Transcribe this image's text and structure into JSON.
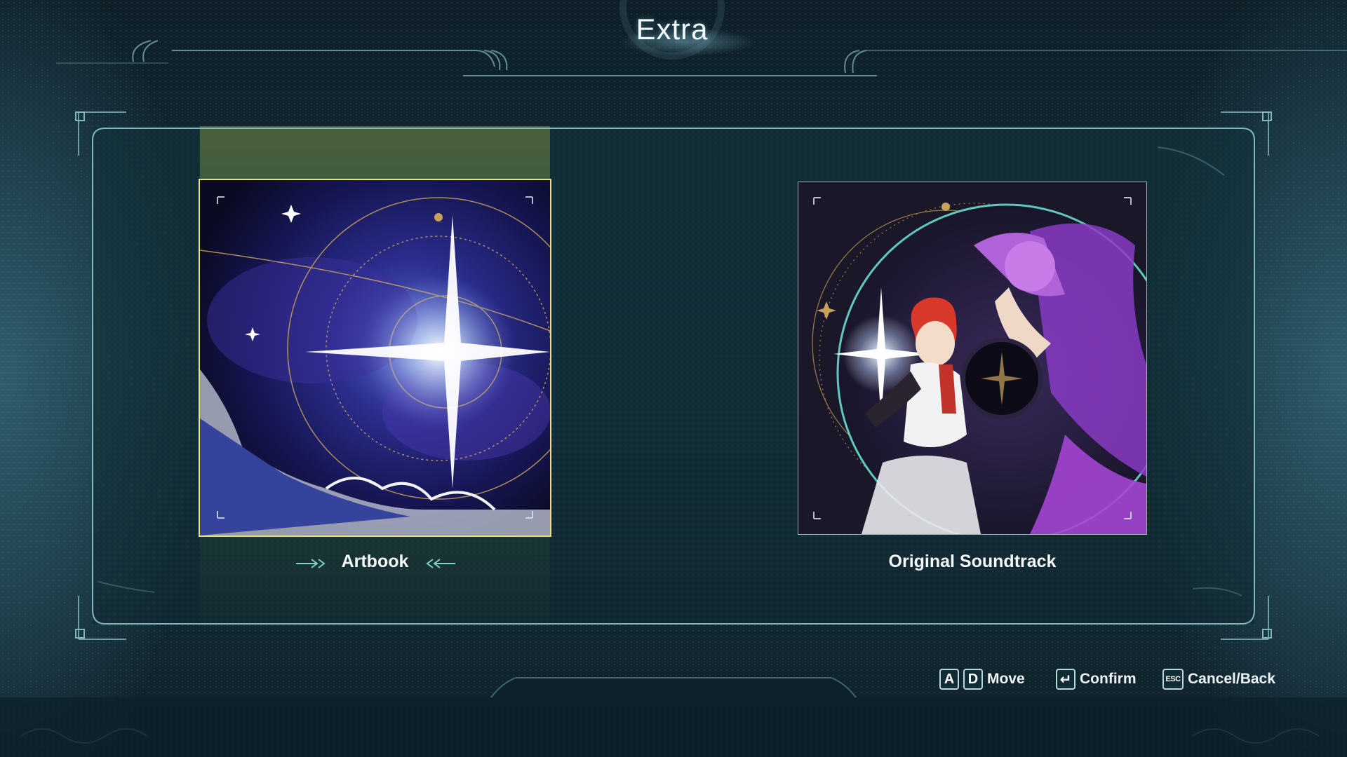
{
  "header": {
    "title": "Extra"
  },
  "cards": [
    {
      "label": "Artbook",
      "selected": true
    },
    {
      "label": "Original Soundtrack",
      "selected": false
    }
  ],
  "footer": {
    "hints": [
      {
        "keys": [
          "A",
          "D"
        ],
        "label": "Move",
        "icon": "arrow-keys-icon"
      },
      {
        "keys": [
          "↵"
        ],
        "label": "Confirm",
        "icon": "enter-key-icon"
      },
      {
        "keys": [
          "ESC"
        ],
        "label": "Cancel/Back",
        "icon": "esc-key-icon"
      }
    ]
  },
  "colors": {
    "accent": "#e8e27a",
    "frame": "#7fb8bd",
    "background": "#15303b",
    "selection_highlight": "#7a8a46"
  }
}
